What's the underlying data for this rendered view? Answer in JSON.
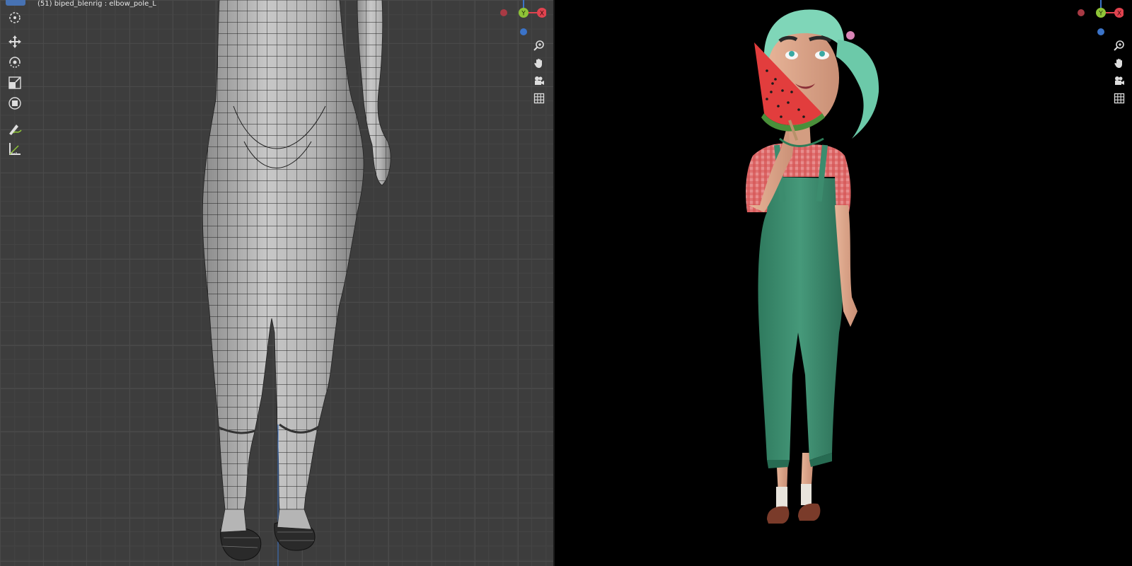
{
  "left_viewport": {
    "header_text": "(51) biped_blenrig : elbow_pole_L",
    "toolbar": [
      {
        "name": "select-box-icon",
        "active": true
      },
      {
        "name": "cursor-icon"
      },
      {
        "name": "move-icon"
      },
      {
        "name": "rotate-icon"
      },
      {
        "name": "scale-icon"
      },
      {
        "name": "transform-icon"
      },
      {
        "name": "annotate-icon"
      },
      {
        "name": "measure-icon"
      }
    ],
    "gizmo": {
      "y_label": "Y",
      "x_label": "X"
    },
    "nav_buttons": [
      "zoom-icon",
      "pan-hand-icon",
      "camera-icon",
      "ortho-grid-icon"
    ]
  },
  "right_viewport": {
    "gizmo": {
      "y_label": "Y",
      "x_label": "X"
    },
    "nav_buttons": [
      "zoom-icon",
      "pan-hand-icon",
      "camera-icon",
      "ortho-grid-icon"
    ]
  },
  "colors": {
    "grid_bg": "#3d3d3d",
    "active_tool": "#4772b3",
    "axis_x": "#e0434f",
    "axis_y": "#8ec437",
    "axis_z": "#3b73c8",
    "overalls": "#3c8c6e",
    "hair": "#7fd6b8",
    "shirt": "#d95a5a",
    "watermelon": "#e23d3d"
  }
}
